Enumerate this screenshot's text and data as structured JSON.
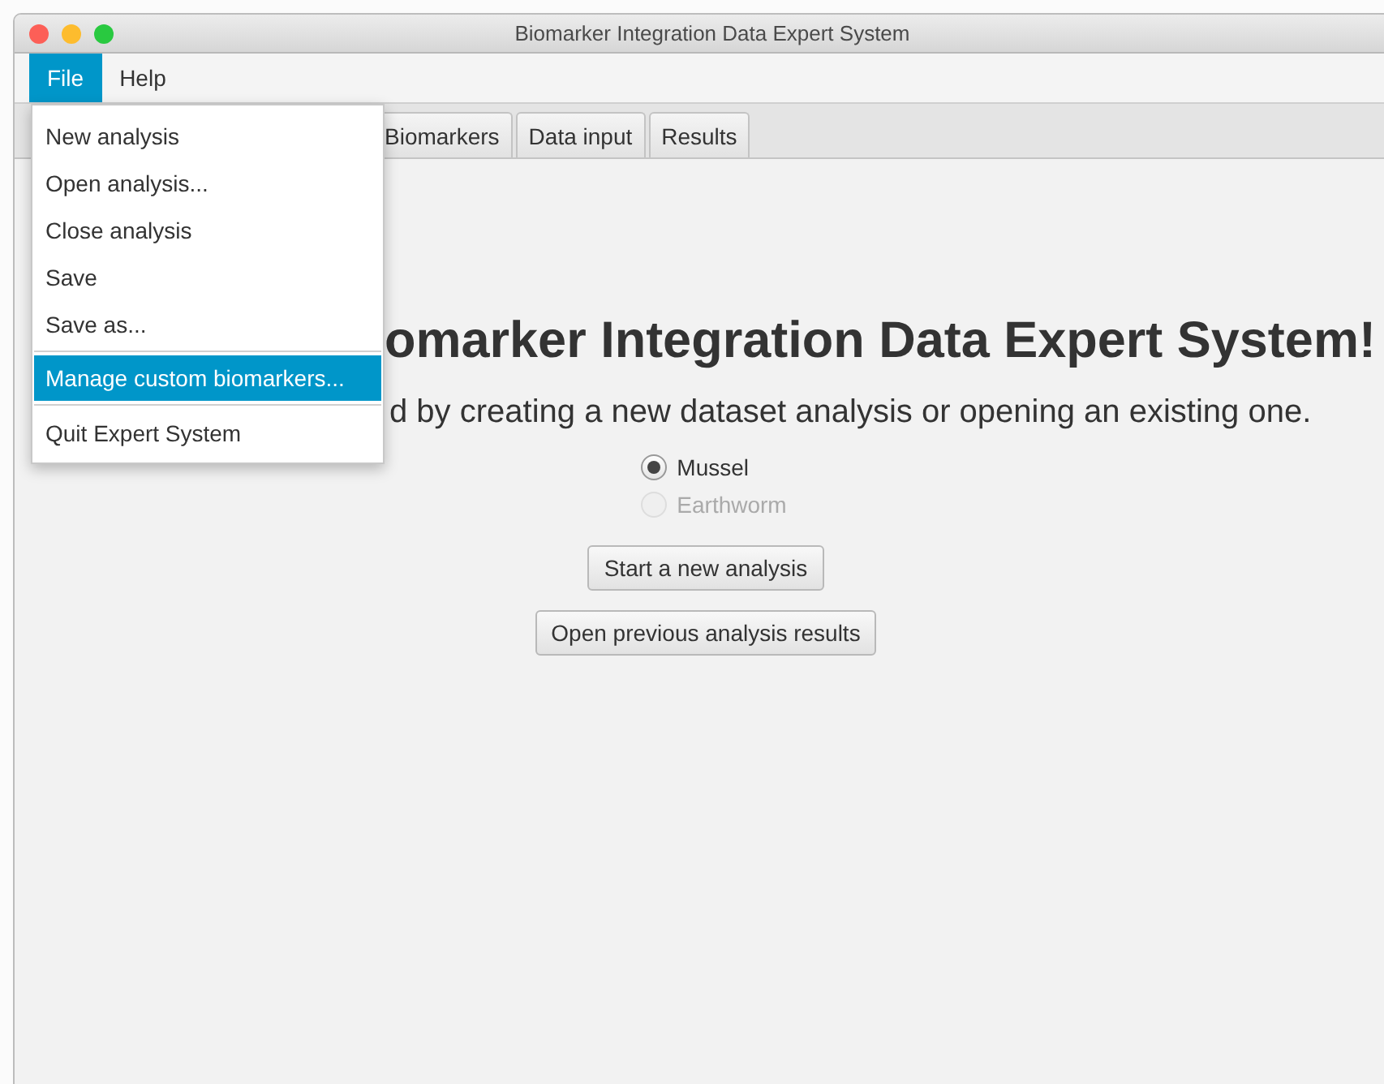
{
  "window": {
    "title": "Biomarker Integration Data Expert System"
  },
  "menubar": [
    {
      "label": "File",
      "selected": true
    },
    {
      "label": "Help",
      "selected": false
    }
  ],
  "file_menu": [
    {
      "kind": "item",
      "label": "New analysis",
      "selected": false
    },
    {
      "kind": "item",
      "label": "Open analysis...",
      "selected": false
    },
    {
      "kind": "item",
      "label": "Close analysis",
      "selected": false
    },
    {
      "kind": "item",
      "label": "Save",
      "selected": false
    },
    {
      "kind": "item",
      "label": "Save as...",
      "selected": false
    },
    {
      "kind": "separator"
    },
    {
      "kind": "item",
      "label": "Manage custom biomarkers...",
      "selected": true
    },
    {
      "kind": "separator"
    },
    {
      "kind": "item",
      "label": "Quit Expert System",
      "selected": false
    }
  ],
  "tabs": [
    {
      "label": "Biomarkers",
      "selected": false
    },
    {
      "label": "Data input",
      "selected": false
    },
    {
      "label": "Results",
      "selected": false
    }
  ],
  "heading": "omarker Integration Data Expert System!",
  "subtitle": "d by creating a new dataset analysis or opening an existing one.",
  "species": [
    {
      "label": "Mussel",
      "checked": true,
      "disabled": false
    },
    {
      "label": "Earthworm",
      "checked": false,
      "disabled": true
    }
  ],
  "buttons": [
    "Start a new analysis",
    "Open previous analysis results"
  ]
}
